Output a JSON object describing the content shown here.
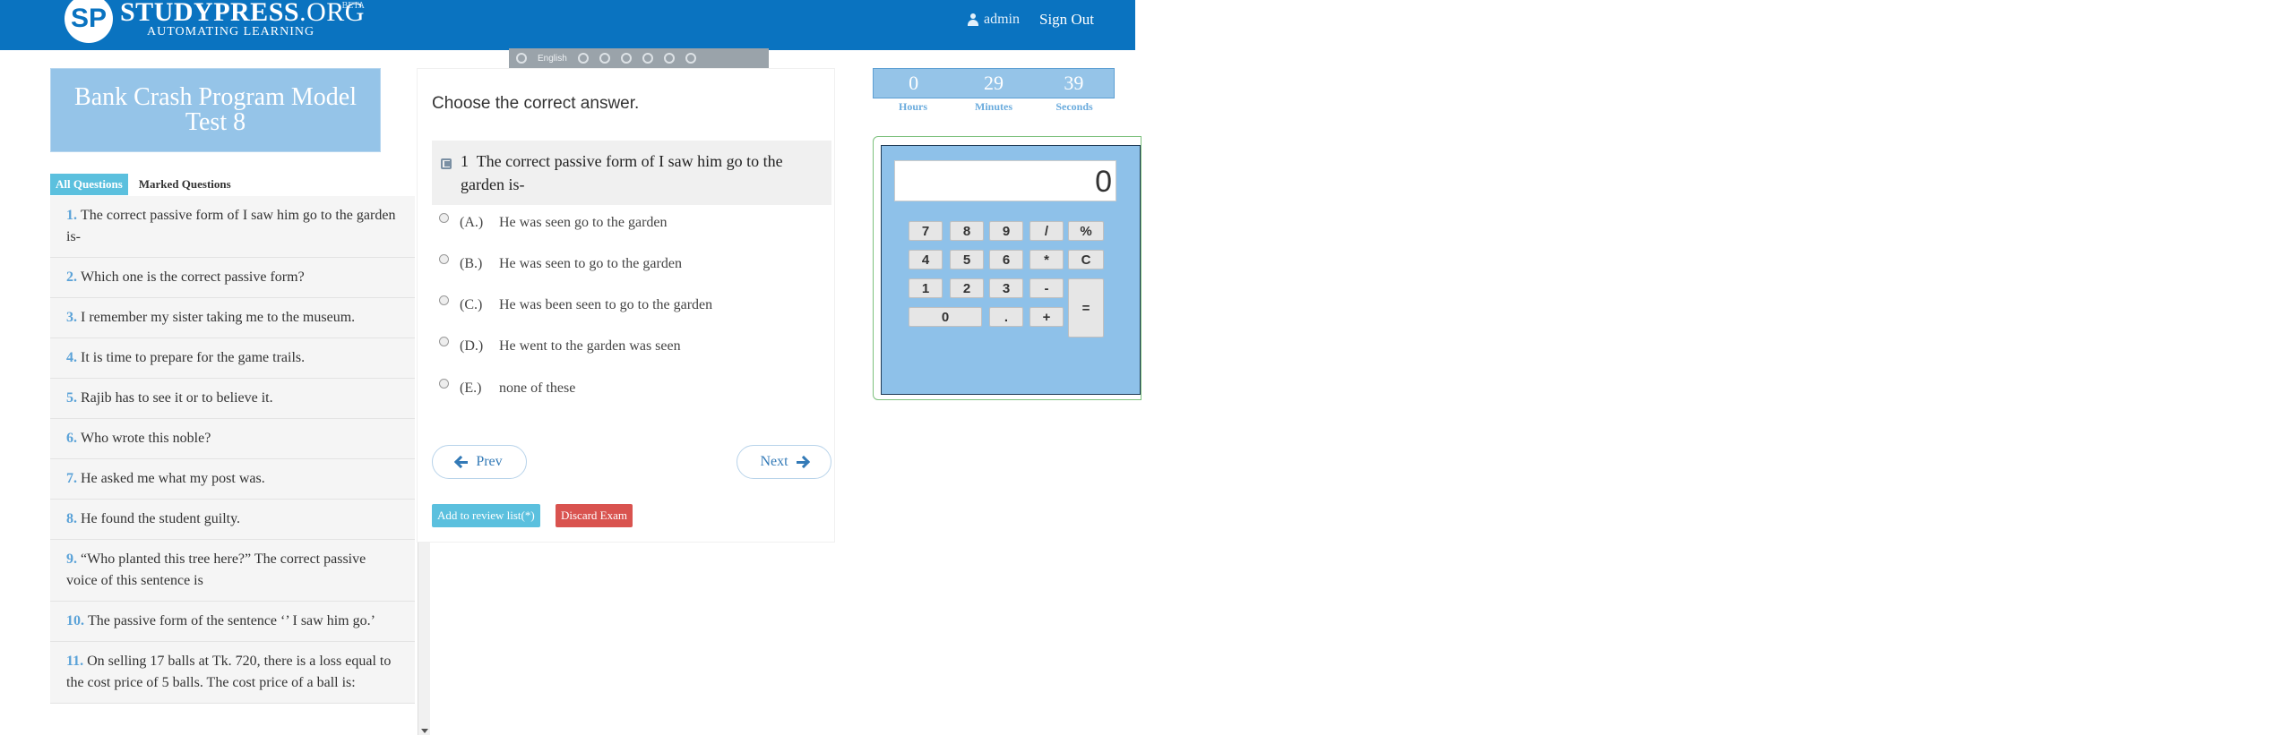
{
  "header": {
    "logo_mark": "SP",
    "logo_main": "STUDYPRESS",
    "logo_org": ".ORG",
    "logo_beta": "BETA",
    "logo_sub": "AUTOMATING LEARNING",
    "user": "admin",
    "signout": "Sign Out"
  },
  "toolbar": {
    "language": "English"
  },
  "left": {
    "exam_title": "Bank Crash Program Model Test 8",
    "tab_all": "All Questions",
    "tab_marked": "Marked Questions",
    "questions": [
      {
        "num": "1.",
        "text": "The correct passive form of I saw him go to the garden is-"
      },
      {
        "num": "2.",
        "text": "Which one is the  correct passive form?"
      },
      {
        "num": "3.",
        "text": "I remember my sister taking me to the museum."
      },
      {
        "num": "4.",
        "text": "It is time to prepare for the game trails."
      },
      {
        "num": "5.",
        "text": "Rajib has to see it or to believe it."
      },
      {
        "num": "6.",
        "text": "Who wrote this noble?"
      },
      {
        "num": "7.",
        "text": "He asked me what my post was."
      },
      {
        "num": "8.",
        "text": "He found the student guilty."
      },
      {
        "num": "9.",
        "text": "“Who planted this tree here?” The correct passive voice of this sentence is"
      },
      {
        "num": "10.",
        "text": "The passive form of the sentence ‘’ I saw him go.’"
      },
      {
        "num": "11.",
        "text": "On selling 17 balls at Tk. 720, there is a loss equal to the cost price of 5 balls. The cost price of a ball is:"
      }
    ]
  },
  "main": {
    "instruction": "Choose the correct answer.",
    "question_number": "1",
    "question_text": "The correct passive form of I saw him go to the garden is-",
    "options": [
      {
        "letter": "(A.)",
        "text": "He was seen go to the garden"
      },
      {
        "letter": "(B.)",
        "text": "He was seen to go to the garden"
      },
      {
        "letter": "(C.)",
        "text": "He was been seen to go to the garden"
      },
      {
        "letter": "(D.)",
        "text": "He went to the garden was seen"
      },
      {
        "letter": "(E.)",
        "text": "none of these"
      }
    ],
    "prev": "Prev",
    "next": "Next",
    "review": "Add to review list(*)",
    "discard": "Discard Exam"
  },
  "timer": {
    "hours": "0",
    "minutes": "29",
    "seconds": "39",
    "hours_label": "Hours",
    "minutes_label": "Minutes",
    "seconds_label": "Seconds"
  },
  "calculator": {
    "display": "0",
    "keys": [
      "7",
      "8",
      "9",
      "/",
      "%",
      "4",
      "5",
      "6",
      "*",
      "C",
      "1",
      "2",
      "3",
      "-",
      "=",
      "0",
      ".",
      "+"
    ]
  },
  "colors": {
    "brand": "#0a73c0",
    "accent": "#95c4e8",
    "danger": "#d9534f",
    "info": "#5bc0de"
  }
}
